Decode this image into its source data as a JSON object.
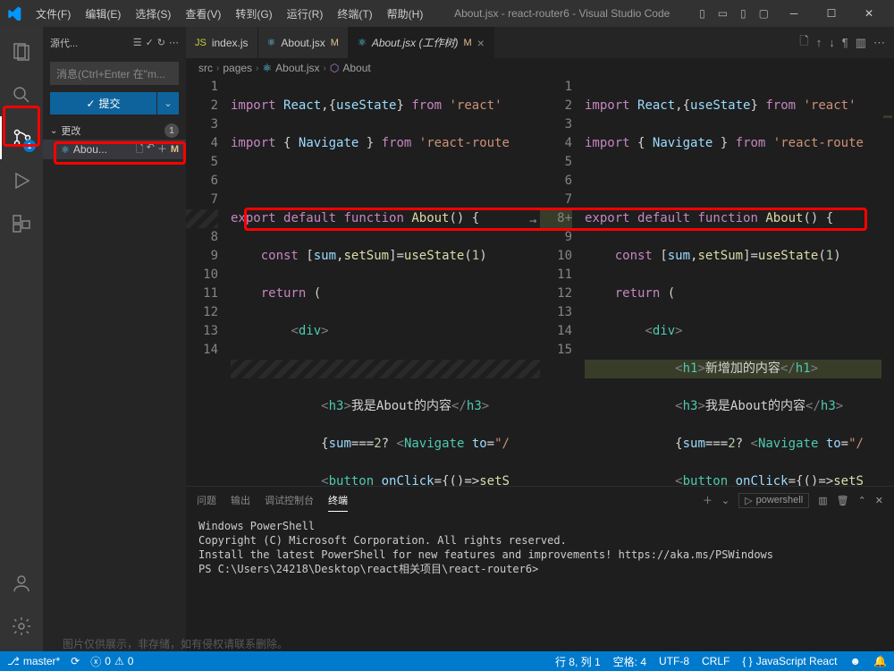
{
  "title": "About.jsx - react-router6 - Visual Studio Code",
  "menu": [
    "文件(F)",
    "编辑(E)",
    "选择(S)",
    "查看(V)",
    "转到(G)",
    "运行(R)",
    "终端(T)",
    "帮助(H)"
  ],
  "activity": {
    "badge_scm": "1"
  },
  "sidebar": {
    "title": "源代...",
    "message_placeholder": "消息(Ctrl+Enter 在\"m...",
    "commit": "提交",
    "changes_label": "更改",
    "changes_count": "1",
    "file": {
      "name": "Abou...",
      "status": "M"
    }
  },
  "tabs": [
    {
      "icon": "js",
      "label": "index.js",
      "modified": false,
      "italic": false
    },
    {
      "icon": "react",
      "label": "About.jsx",
      "modified": true,
      "mod": "M",
      "italic": false
    },
    {
      "icon": "react",
      "label": "About.jsx (工作树)",
      "modified": true,
      "mod": "M",
      "italic": true,
      "active": true
    }
  ],
  "breadcrumbs": [
    "src",
    "pages",
    "About.jsx",
    "About"
  ],
  "code_left": {
    "lines": [
      1,
      2,
      3,
      4,
      5,
      6,
      7,
      null,
      8,
      9,
      10,
      11,
      12,
      13,
      14
    ]
  },
  "code_right": {
    "lines": [
      1,
      2,
      3,
      4,
      5,
      6,
      7,
      "8+",
      9,
      10,
      11,
      12,
      13,
      14,
      15
    ],
    "added_text": "新增加的内容"
  },
  "panel": {
    "tabs": [
      "问题",
      "输出",
      "调试控制台",
      "终端"
    ],
    "active": 3,
    "shell": "powershell"
  },
  "terminal": [
    "Windows PowerShell",
    "Copyright (C) Microsoft Corporation. All rights reserved.",
    "",
    "Install the latest PowerShell for new features and improvements! https://aka.ms/PSWindows",
    "",
    "PS C:\\Users\\24218\\Desktop\\react相关项目\\react-router6>"
  ],
  "status": {
    "branch": "master*",
    "sync": "",
    "errors": "0",
    "warnings": "0",
    "line": "行 8, 列 1",
    "spaces": "空格: 4",
    "encoding": "UTF-8",
    "eol": "CRLF",
    "lang": "JavaScript React",
    "feedback": ""
  },
  "watermark": "图片仅供展示，非存储，如有侵权请联系删除。"
}
